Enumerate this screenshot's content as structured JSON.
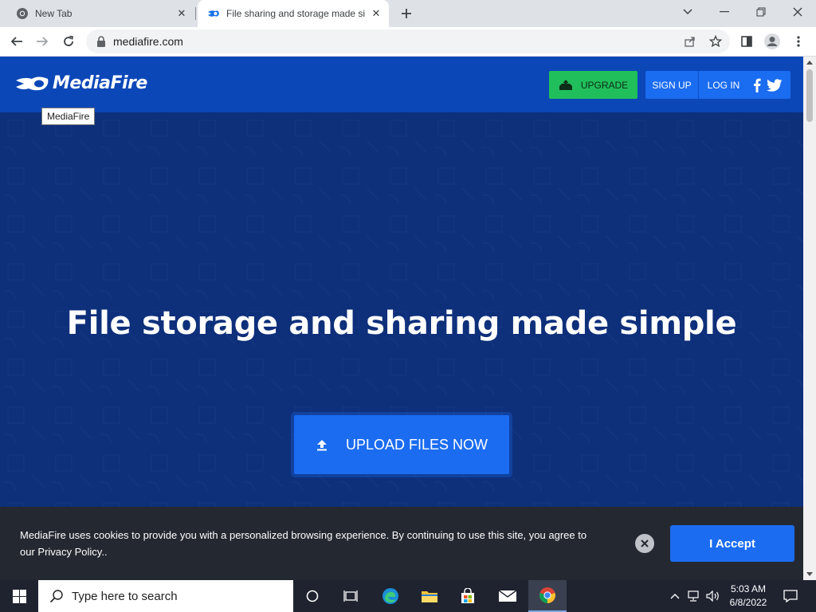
{
  "browser": {
    "tabs": [
      {
        "title": "New Tab",
        "active": false
      },
      {
        "title": "File sharing and storage made si",
        "active": true
      }
    ],
    "url": "mediafire.com"
  },
  "site": {
    "logo_text": "MediaFire",
    "tooltip": "MediaFire",
    "nav": {
      "upgrade": "UPGRADE",
      "signup": "SIGN UP",
      "login": "LOG IN"
    },
    "hero": {
      "title": "File storage and sharing made simple",
      "upload_button": "UPLOAD FILES NOW"
    },
    "cookie": {
      "text": "MediaFire uses cookies to provide you with a personalized browsing experience. By continuing to use this site, you agree to our Privacy Policy..",
      "accept": "I Accept"
    },
    "colors": {
      "header": "#0c47b8",
      "hero": "#0e2f7a",
      "primary_button": "#1b6cf0",
      "upgrade_button": "#21bf5b",
      "cookie_bar": "#242831"
    }
  },
  "taskbar": {
    "search_placeholder": "Type here to search",
    "time": "5:03 AM",
    "date": "6/8/2022",
    "apps": [
      "task-view",
      "edge",
      "file-explorer",
      "store",
      "mail",
      "chrome"
    ]
  }
}
